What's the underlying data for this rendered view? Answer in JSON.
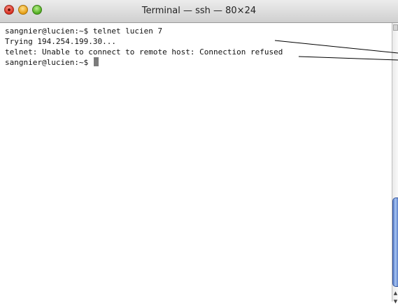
{
  "window": {
    "title": "Terminal — ssh — 80×24"
  },
  "terminal": {
    "lines": [
      "sangnier@lucien:~$ telnet lucien 7",
      "Trying 194.254.199.30...",
      "telnet: Unable to connect to remote host: Connection refused"
    ],
    "prompt": "sangnier@lucien:~$ "
  },
  "colors": {
    "close": "#d52a1b",
    "minimize": "#e49c12",
    "zoom": "#4eab1e",
    "scroll_thumb": "#5a7ec8"
  },
  "icons": {
    "scroll_up": "scroll-up-arrow-icon",
    "scroll_down": "scroll-down-arrow-icon"
  }
}
